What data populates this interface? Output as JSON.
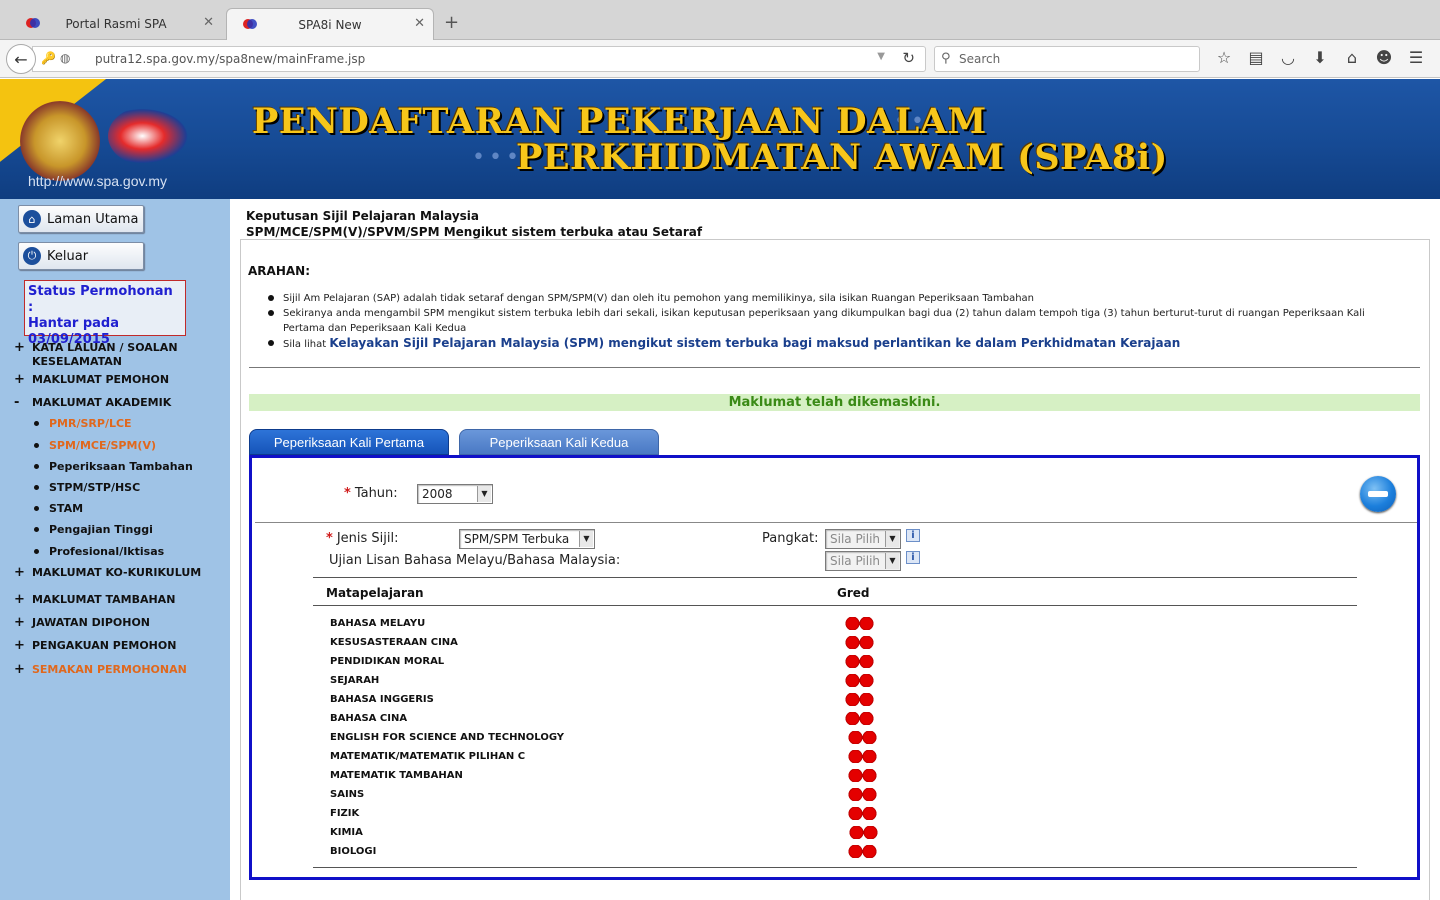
{
  "browser": {
    "tabs": [
      {
        "title": "Portal Rasmi SPA",
        "active": false
      },
      {
        "title": "SPA8i New",
        "active": true
      }
    ],
    "url": "putra12.spa.gov.my/spa8new/mainFrame.jsp",
    "search_placeholder": "Search"
  },
  "banner": {
    "title_line1": "PENDAFTARAN PEKERJAAN DALAM",
    "title_line2": "PERKHIDMATAN AWAM (SPA8i)",
    "url": "http://www.spa.gov.my"
  },
  "sidebar": {
    "home_button": "Laman Utama",
    "logout_button": "Keluar",
    "status": {
      "line1": "Status Permohonan :",
      "line2": "Hantar pada",
      "line3": "03/09/2015"
    },
    "menu": [
      {
        "mark": "+",
        "label1": "KATA LALUAN / SOALAN",
        "label2": "KESELAMATAN"
      },
      {
        "mark": "+",
        "label1": "MAKLUMAT PEMOHON"
      },
      {
        "mark": "-",
        "label1": "MAKLUMAT AKADEMIK"
      },
      {
        "mark": "+",
        "label1": "MAKLUMAT KO-KURIKULUM"
      },
      {
        "mark": "+",
        "label1": "MAKLUMAT TAMBAHAN"
      },
      {
        "mark": "+",
        "label1": "JAWATAN DIPOHON"
      },
      {
        "mark": "+",
        "label1": "PENGAKUAN PEMOHON"
      },
      {
        "mark": "+",
        "label1": "SEMAKAN PERMOHONAN"
      }
    ],
    "academic_sub": [
      "PMR/SRP/LCE",
      "SPM/MCE/SPM(V)",
      "Peperiksaan Tambahan",
      "STPM/STP/HSC",
      "STAM",
      "Pengajian Tinggi",
      "Profesional/Iktisas"
    ]
  },
  "main": {
    "heading_line1": "Keputusan Sijil Pelajaran Malaysia",
    "heading_line2": "SPM/MCE/SPM(V)/SPVM/SPM Mengikut sistem terbuka atau Setaraf",
    "arahan_label": "ARAHAN:",
    "bullets": [
      "Sijil Am Pelajaran (SAP) adalah tidak setaraf dengan SPM/SPM(V) dan oleh itu pemohon yang memilikinya, sila isikan Ruangan Peperiksaan Tambahan",
      "Sekiranya anda mengambil SPM mengikut sistem terbuka lebih dari sekali, isikan keputusan peperiksaan yang dikumpulkan bagi dua (2) tahun dalam tempoh tiga (3) tahun berturut-turut di ruangan Peperiksaan Kali Pertama dan Peperiksaan Kali Kedua"
    ],
    "bullet3_prefix": "Sila lihat",
    "bullet3_link": "Kelayakan Sijil Pelajaran Malaysia (SPM) mengikut sistem terbuka bagi maksud perlantikan ke dalam Perkhidmatan Kerajaan",
    "success_message": "Maklumat telah dikemaskini.",
    "tab1": "Peperiksaan Kali Pertama",
    "tab2": "Peperiksaan Kali Kedua",
    "form": {
      "required_mark": "*",
      "tahun_label": "Tahun:",
      "tahun_value": "2008",
      "jenis_label": "Jenis Sijil:",
      "jenis_value": "SPM/SPM Terbuka",
      "pangkat_label": "Pangkat:",
      "pangkat_value": "Sila Pilih",
      "ujian_label": "Ujian Lisan Bahasa Melayu/Bahasa Malaysia:",
      "ujian_value": "Sila Pilih",
      "info_icon": "i"
    },
    "table": {
      "col_subject": "Matapelajaran",
      "col_grade": "Gred",
      "subjects": [
        "BAHASA MELAYU",
        "KESUSASTERAAN CINA",
        "PENDIDIKAN MORAL",
        "SEJARAH",
        "BAHASA INGGERIS",
        "BAHASA CINA",
        "ENGLISH FOR SCIENCE AND TECHNOLOGY",
        "MATEMATIK/MATEMATIK PILIHAN C",
        "MATEMATIK TAMBAHAN",
        "SAINS",
        "FIZIK",
        "KIMIA",
        "BIOLOGI"
      ]
    }
  },
  "colors": {
    "banner_blue": "#164a94",
    "title_gold": "#f7c61a",
    "sidebar_bg": "#9fc3e6",
    "panel_border": "#1010c8",
    "success_green": "#3a8a16",
    "grade_red": "#e40000"
  }
}
